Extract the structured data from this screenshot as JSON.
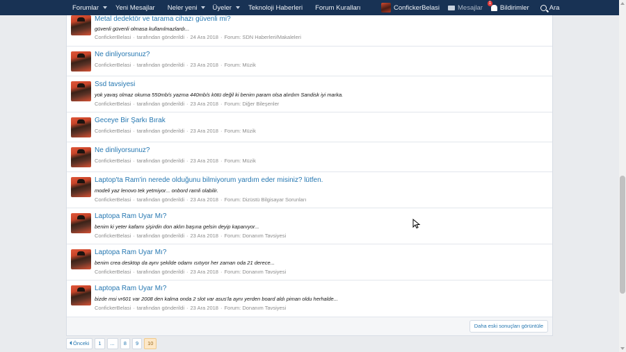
{
  "nav": {
    "left": [
      {
        "label": "Forumlar",
        "dropdown": true
      },
      {
        "label": "Yeni Mesajlar",
        "dropdown": false
      },
      {
        "label": "Neler yeni",
        "dropdown": true
      },
      {
        "label": "Üyeler",
        "dropdown": true
      },
      {
        "label": "Teknoloji Haberleri",
        "dropdown": false
      },
      {
        "label": "Forum Kuralları",
        "dropdown": false
      }
    ],
    "user": "ConfickerBelasi",
    "messages": "Mesajlar",
    "notifications": "Bildirimler",
    "notifications_count": "1",
    "search": "Ara"
  },
  "results": [
    {
      "title": "Metal dedektör ve tarama cihazı güvenli mi?",
      "snippet": "güvenli güvenli olmasa kullanılmazlardı...",
      "author": "ConfickerBelasi",
      "action": "tarafından gönderildi",
      "date": "24 Ara 2018",
      "forum_prefix": "Forum:",
      "forum": "SDN Haberleri/Makaleleri"
    },
    {
      "title": "Ne dinliyorsunuz?",
      "snippet": "",
      "author": "ConfickerBelasi",
      "action": "tarafından gönderildi",
      "date": "23 Ara 2018",
      "forum_prefix": "Forum:",
      "forum": "Müzik"
    },
    {
      "title": "Ssd tavsiyesi",
      "snippet": "yok yavaş olmaz okuma 550mb/s yazma 440mb/s kötü değil ki benim param olsa alırdım Sandisk iyi marka.",
      "author": "ConfickerBelasi",
      "action": "tarafından gönderildi",
      "date": "23 Ara 2018",
      "forum_prefix": "Forum:",
      "forum": "Diğer Bileşenler"
    },
    {
      "title": "Geceye Bir Şarkı Bırak",
      "snippet": "",
      "author": "ConfickerBelasi",
      "action": "tarafından gönderildi",
      "date": "23 Ara 2018",
      "forum_prefix": "Forum:",
      "forum": "Müzik"
    },
    {
      "title": "Ne dinliyorsunuz?",
      "snippet": "",
      "author": "ConfickerBelasi",
      "action": "tarafından gönderildi",
      "date": "23 Ara 2018",
      "forum_prefix": "Forum:",
      "forum": "Müzik"
    },
    {
      "title": "Laptop'ta Ram'in nerede olduğunu bilmiyorum yardım eder misiniz? lütfen.",
      "snippet": "modeli yaz lenovo tek yetmiyor... onbord ramli olabilir.",
      "author": "ConfickerBelasi",
      "action": "tarafından gönderildi",
      "date": "23 Ara 2018",
      "forum_prefix": "Forum:",
      "forum": "Dizüstü Bilgisayar Sorunları"
    },
    {
      "title": "Laptopa Ram Uyar Mı?",
      "snippet": "benim ki yeter kafamı şişirdin don aklın başına gelsin deyip kapanıyor...",
      "author": "ConfickerBelasi",
      "action": "tarafından gönderildi",
      "date": "23 Ara 2018",
      "forum_prefix": "Forum:",
      "forum": "Donanım Tavsiyesi"
    },
    {
      "title": "Laptopa Ram Uyar Mı?",
      "snippet": "benim crea desktop da aynı şekilde odamı ısıtıyor her zaman oda 21 derece...",
      "author": "ConfickerBelasi",
      "action": "tarafından gönderildi",
      "date": "23 Ara 2018",
      "forum_prefix": "Forum:",
      "forum": "Donanım Tavsiyesi"
    },
    {
      "title": "Laptopa Ram Uyar Mı?",
      "snippet": "bizde msi vr601 var 2008 den kalma onda 2 slot var asus'la aynı yerden board aldı piman oldu herhalde...",
      "author": "ConfickerBelasi",
      "action": "tarafından gönderildi",
      "date": "23 Ara 2018",
      "forum_prefix": "Forum:",
      "forum": "Donanım Tavsiyesi"
    }
  ],
  "footer": {
    "older_results": "Daha eski sonuçları görüntüle"
  },
  "pagination": {
    "prev": "Önceki",
    "pages": [
      "1",
      "...",
      "8",
      "9",
      "10"
    ],
    "current": "10"
  }
}
